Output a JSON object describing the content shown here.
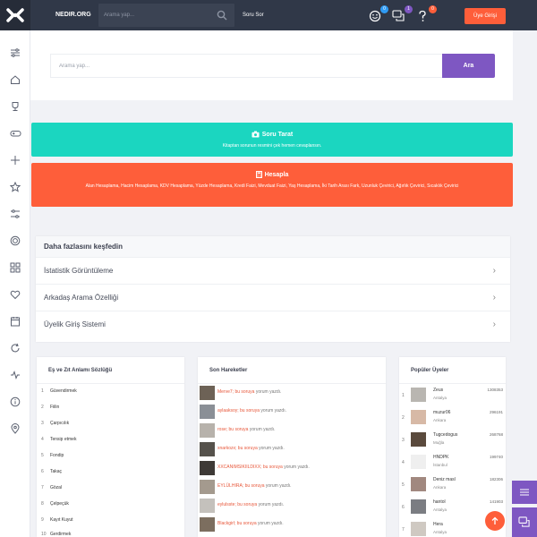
{
  "brand": "NEDIR.ORG",
  "header": {
    "search_placeholder": "Arama yap...",
    "ask_label": "Soru Sor",
    "badges": {
      "messages": "0",
      "questions": "1",
      "notifications": "0"
    },
    "login_label": "Üye Girişi"
  },
  "main_search": {
    "placeholder": "Arama yap...",
    "button_label": "Ara"
  },
  "banners": [
    {
      "title": "Soru Tarat",
      "subtitle": "Kitaptan sorunun resmini çek hemen cevaplansın."
    },
    {
      "title": "Hesapla",
      "subtitle": "Alan Hesaplama, Hacim Hesaplama, KDV Hesaplama, Yüzde Hesaplama, Kredi Faizi, Mevduat Faizi, Yaş Hesaplama, İki Tarih Arası Fark, Uzunluk Çevirici, Ağırlık Çevirici, Sıcaklık Çevirici"
    }
  ],
  "discover": {
    "title": "Daha fazlasını keşfedin",
    "items": [
      "İstatistik Görüntüleme",
      "Arkadaş Arama Özelliği",
      "Üyelik Giriş Sistemi"
    ]
  },
  "dictionary": {
    "title": "Eş ve Zıt Anlamı Sözlüğü",
    "items": [
      {
        "n": "1",
        "w": "Güvendirmek"
      },
      {
        "n": "2",
        "w": "Fiilin"
      },
      {
        "n": "3",
        "w": "Çarpıcılık"
      },
      {
        "n": "4",
        "w": "Tensip etmek"
      },
      {
        "n": "5",
        "w": "Fondip"
      },
      {
        "n": "6",
        "w": "Takaç"
      },
      {
        "n": "7",
        "w": "Gözal"
      },
      {
        "n": "8",
        "w": "Çelpeçük"
      },
      {
        "n": "9",
        "w": "Kayıt Kuyut"
      },
      {
        "n": "10",
        "w": "Gerdirmek"
      }
    ]
  },
  "activity": {
    "title": "Son Hareketler",
    "items": [
      {
        "user": "Merve7; bu soruya",
        "action": "yorum yazdı."
      },
      {
        "user": "aylaaksoy; bu soruya",
        "action": "yorum yazdı."
      },
      {
        "user": "rose; bu soruya",
        "action": "yorum yazdı."
      },
      {
        "user": "xnarkozx; bu soruya",
        "action": "yorum yazdı."
      },
      {
        "user": "XXCANIMSIKIILDIXX; bu soruya",
        "action": "yorum yazdı."
      },
      {
        "user": "EYLÜLHIRA; bu soruya",
        "action": "yorum yazdı."
      },
      {
        "user": "eylulsste; bu soruya",
        "action": "yorum yazdı."
      },
      {
        "user": "Blackgirl; bu soruya",
        "action": "yorum yazdı."
      }
    ]
  },
  "popular": {
    "title": "Popüler Üyeler",
    "items": [
      {
        "n": "1",
        "name": "Zeus",
        "city": "Antalya",
        "score": "1308353"
      },
      {
        "n": "2",
        "name": "muzur06",
        "city": "Ankara",
        "score": "296191"
      },
      {
        "n": "3",
        "name": "Tugcedogus",
        "city": "Muğla",
        "score": "268768"
      },
      {
        "n": "4",
        "name": "HNDPK",
        "city": "İstanbul",
        "score": "199740"
      },
      {
        "n": "5",
        "name": "Deniz masl",
        "city": "Ankara",
        "score": "182306"
      },
      {
        "n": "6",
        "name": "hantol",
        "city": "Antalya",
        "score": "141903"
      },
      {
        "n": "7",
        "name": "Hera",
        "city": "Antalya",
        "score": ""
      }
    ]
  },
  "colors": {
    "topbar": "#303848",
    "accent": "#7e57c2",
    "teal": "#1bd6c0",
    "orange": "#fe5e3a"
  }
}
